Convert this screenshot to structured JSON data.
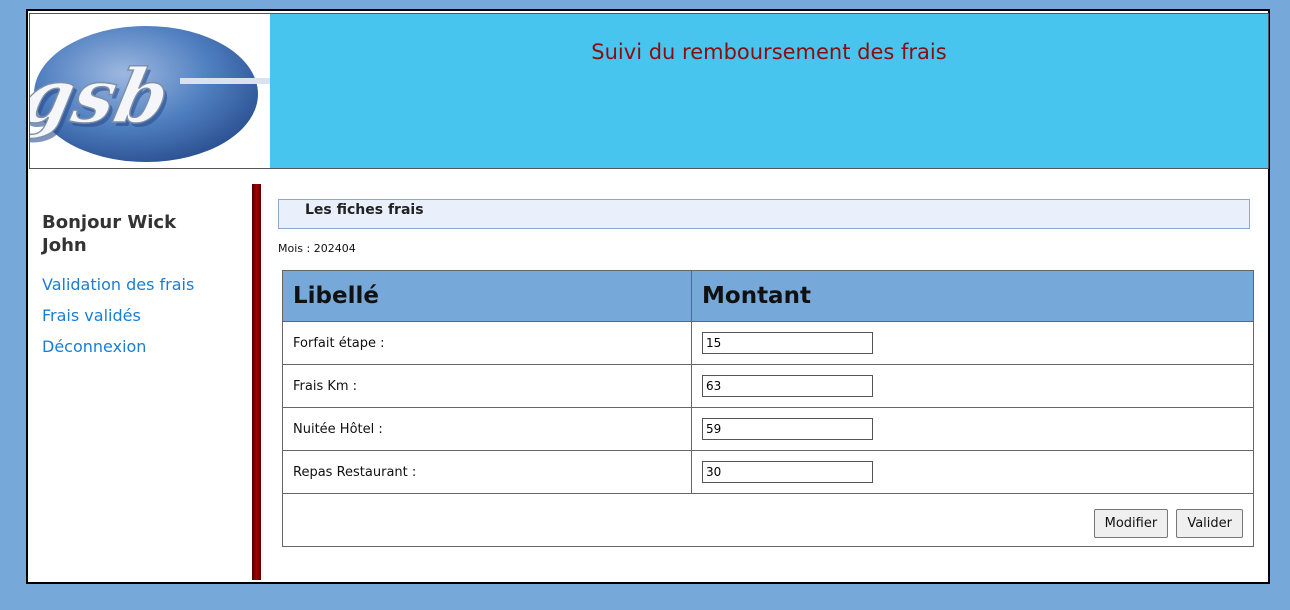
{
  "header": {
    "title": "Suivi du remboursement des frais",
    "logo_text": "gsb"
  },
  "sidebar": {
    "greeting": "Bonjour Wick John",
    "items": [
      {
        "label": "Validation des frais"
      },
      {
        "label": "Frais validés"
      },
      {
        "label": "Déconnexion"
      }
    ]
  },
  "main": {
    "section_title": "Les fiches frais",
    "month": "Mois : 202404",
    "table": {
      "headers": [
        "Libellé",
        "Montant"
      ],
      "rows": [
        {
          "label": "Forfait étape :",
          "value": "15"
        },
        {
          "label": "Frais Km :",
          "value": "63"
        },
        {
          "label": "Nuitée Hôtel :",
          "value": "59"
        },
        {
          "label": "Repas Restaurant :",
          "value": "30"
        }
      ]
    },
    "buttons": {
      "modify": "Modifier",
      "validate": "Valider"
    }
  },
  "colors": {
    "background": "#77A8DA",
    "header": "#47C5EF",
    "title": "#8B0E0E",
    "link": "#1A7DD6"
  }
}
